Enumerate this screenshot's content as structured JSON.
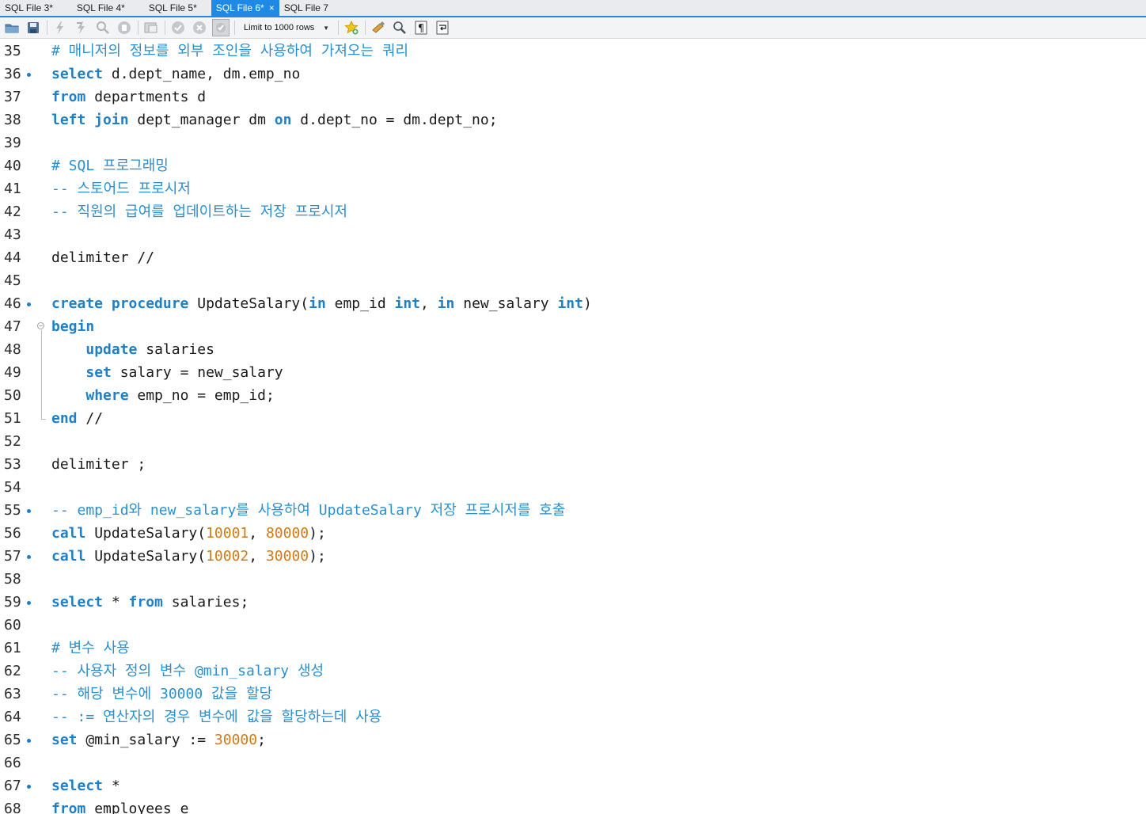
{
  "tabs": [
    {
      "label": "SQL File 3*",
      "active": false
    },
    {
      "label": "SQL File 4*",
      "active": false
    },
    {
      "label": "SQL File 5*",
      "active": false
    },
    {
      "label": "SQL File 6*",
      "active": true
    },
    {
      "label": "SQL File 7",
      "active": false
    }
  ],
  "tab_close_glyph": "×",
  "toolbar": {
    "limit_label": "Limit to 1000 rows",
    "icons": [
      "open-file-icon",
      "save-icon",
      "execute-icon",
      "execute-current-icon",
      "explain-icon",
      "stop-icon",
      "toggle-output-icon",
      "commit-icon",
      "rollback-icon",
      "autocommit-icon",
      "add-snippet-icon",
      "beautify-icon",
      "find-icon",
      "invisible-chars-icon",
      "word-wrap-icon"
    ]
  },
  "colors": {
    "keyword": "#1f7fc7",
    "number": "#d07a16",
    "comment": "#2a8fcf",
    "active_tab": "#1e8ae6"
  },
  "editor": {
    "lines": [
      {
        "n": "35",
        "marker": false,
        "tokens": [
          {
            "t": "cm",
            "v": "# 매니저의 정보를 외부 조인을 사용하여 가져오는 쿼리"
          }
        ]
      },
      {
        "n": "36",
        "marker": true,
        "tokens": [
          {
            "t": "kw",
            "v": "select"
          },
          {
            "t": "tx",
            "v": " d.dept_name, dm.emp_no"
          }
        ]
      },
      {
        "n": "37",
        "marker": false,
        "tokens": [
          {
            "t": "kw",
            "v": "from"
          },
          {
            "t": "tx",
            "v": " departments d"
          }
        ]
      },
      {
        "n": "38",
        "marker": false,
        "tokens": [
          {
            "t": "kw",
            "v": "left join"
          },
          {
            "t": "tx",
            "v": " dept_manager dm "
          },
          {
            "t": "kw",
            "v": "on"
          },
          {
            "t": "tx",
            "v": " d.dept_no = dm.dept_no;"
          }
        ]
      },
      {
        "n": "39",
        "marker": false,
        "tokens": []
      },
      {
        "n": "40",
        "marker": false,
        "tokens": [
          {
            "t": "cm",
            "v": "# SQL 프로그래밍"
          }
        ]
      },
      {
        "n": "41",
        "marker": false,
        "tokens": [
          {
            "t": "cm",
            "v": "-- 스토어드 프로시저"
          }
        ]
      },
      {
        "n": "42",
        "marker": false,
        "tokens": [
          {
            "t": "cm",
            "v": "-- 직원의 급여를 업데이트하는 저장 프로시저"
          }
        ]
      },
      {
        "n": "43",
        "marker": false,
        "tokens": []
      },
      {
        "n": "44",
        "marker": false,
        "tokens": [
          {
            "t": "tx",
            "v": "delimiter //"
          }
        ]
      },
      {
        "n": "45",
        "marker": false,
        "tokens": []
      },
      {
        "n": "46",
        "marker": true,
        "tokens": [
          {
            "t": "kw",
            "v": "create procedure"
          },
          {
            "t": "tx",
            "v": " UpdateSalary("
          },
          {
            "t": "kw",
            "v": "in"
          },
          {
            "t": "tx",
            "v": " emp_id "
          },
          {
            "t": "kw",
            "v": "int"
          },
          {
            "t": "tx",
            "v": ", "
          },
          {
            "t": "kw",
            "v": "in"
          },
          {
            "t": "tx",
            "v": " new_salary "
          },
          {
            "t": "kw",
            "v": "int"
          },
          {
            "t": "tx",
            "v": ")"
          }
        ]
      },
      {
        "n": "47",
        "marker": false,
        "fold": "start",
        "tokens": [
          {
            "t": "kw",
            "v": "begin"
          }
        ]
      },
      {
        "n": "48",
        "marker": false,
        "tokens": [
          {
            "t": "tx",
            "v": "    "
          },
          {
            "t": "kw",
            "v": "update"
          },
          {
            "t": "tx",
            "v": " salaries"
          }
        ]
      },
      {
        "n": "49",
        "marker": false,
        "tokens": [
          {
            "t": "tx",
            "v": "    "
          },
          {
            "t": "kw",
            "v": "set"
          },
          {
            "t": "tx",
            "v": " salary = new_salary"
          }
        ]
      },
      {
        "n": "50",
        "marker": false,
        "tokens": [
          {
            "t": "tx",
            "v": "    "
          },
          {
            "t": "kw",
            "v": "where"
          },
          {
            "t": "tx",
            "v": " emp_no = emp_id;"
          }
        ]
      },
      {
        "n": "51",
        "marker": false,
        "fold": "end",
        "tokens": [
          {
            "t": "kw",
            "v": "end"
          },
          {
            "t": "tx",
            "v": " //"
          }
        ]
      },
      {
        "n": "52",
        "marker": false,
        "tokens": []
      },
      {
        "n": "53",
        "marker": false,
        "tokens": [
          {
            "t": "tx",
            "v": "delimiter ;"
          }
        ]
      },
      {
        "n": "54",
        "marker": false,
        "tokens": []
      },
      {
        "n": "55",
        "marker": true,
        "tokens": [
          {
            "t": "cm",
            "v": "-- emp_id와 new_salary를 사용하여 UpdateSalary 저장 프로시저를 호출"
          }
        ]
      },
      {
        "n": "56",
        "marker": false,
        "tokens": [
          {
            "t": "kw",
            "v": "call"
          },
          {
            "t": "tx",
            "v": " UpdateSalary("
          },
          {
            "t": "num",
            "v": "10001"
          },
          {
            "t": "tx",
            "v": ", "
          },
          {
            "t": "num",
            "v": "80000"
          },
          {
            "t": "tx",
            "v": ");"
          }
        ]
      },
      {
        "n": "57",
        "marker": true,
        "tokens": [
          {
            "t": "kw",
            "v": "call"
          },
          {
            "t": "tx",
            "v": " UpdateSalary("
          },
          {
            "t": "num",
            "v": "10002"
          },
          {
            "t": "tx",
            "v": ", "
          },
          {
            "t": "num",
            "v": "30000"
          },
          {
            "t": "tx",
            "v": ");"
          }
        ]
      },
      {
        "n": "58",
        "marker": false,
        "tokens": []
      },
      {
        "n": "59",
        "marker": true,
        "tokens": [
          {
            "t": "kw",
            "v": "select"
          },
          {
            "t": "tx",
            "v": " * "
          },
          {
            "t": "kw",
            "v": "from"
          },
          {
            "t": "tx",
            "v": " salaries;"
          }
        ]
      },
      {
        "n": "60",
        "marker": false,
        "tokens": []
      },
      {
        "n": "61",
        "marker": false,
        "tokens": [
          {
            "t": "cm",
            "v": "# 변수 사용"
          }
        ]
      },
      {
        "n": "62",
        "marker": false,
        "tokens": [
          {
            "t": "cm",
            "v": "-- 사용자 정의 변수 @min_salary 생성"
          }
        ]
      },
      {
        "n": "63",
        "marker": false,
        "tokens": [
          {
            "t": "cm",
            "v": "-- 해당 변수에 30000 값을 할당"
          }
        ]
      },
      {
        "n": "64",
        "marker": false,
        "tokens": [
          {
            "t": "cm",
            "v": "-- := 연산자의 경우 변수에 값을 할당하는데 사용"
          }
        ]
      },
      {
        "n": "65",
        "marker": true,
        "tokens": [
          {
            "t": "kw",
            "v": "set"
          },
          {
            "t": "tx",
            "v": " @min_salary := "
          },
          {
            "t": "num",
            "v": "30000"
          },
          {
            "t": "tx",
            "v": ";"
          }
        ]
      },
      {
        "n": "66",
        "marker": false,
        "tokens": []
      },
      {
        "n": "67",
        "marker": true,
        "tokens": [
          {
            "t": "kw",
            "v": "select"
          },
          {
            "t": "tx",
            "v": " *"
          }
        ]
      },
      {
        "n": "68",
        "marker": false,
        "tokens": [
          {
            "t": "kw",
            "v": "from"
          },
          {
            "t": "tx",
            "v": " employees e"
          }
        ]
      }
    ]
  }
}
